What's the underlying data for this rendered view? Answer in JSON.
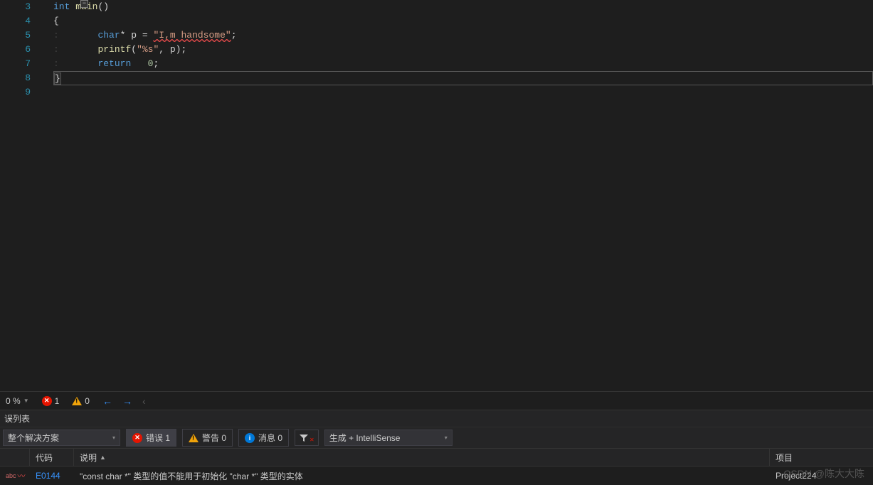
{
  "editor": {
    "lines": [
      "3",
      "4",
      "5",
      "6",
      "7",
      "8",
      "9"
    ],
    "code3_kw1": "int",
    "code3_fn": "main",
    "code3_rest": "()",
    "code4": "{",
    "code5_kw": "char",
    "code5_mid": "* p = ",
    "code5_str": "\"I,m handsome\"",
    "code5_end": ";",
    "code6_fn": "printf",
    "code6_paren": "(",
    "code6_fmt": "\"%s\"",
    "code6_args": ", p)",
    "code6_end": ";",
    "code7_kw": "return",
    "code7_sp": "   ",
    "code7_num": "0",
    "code7_end": ";",
    "code8": "}"
  },
  "statusbar": {
    "zoom": "0 %",
    "errors": "1",
    "warnings": "0"
  },
  "errlist": {
    "title": "误列表",
    "scope": "整个解决方案",
    "errorsBtn": "错误 1",
    "warnBtn": "警告 0",
    "msgBtn": "消息 0",
    "filterCombo": "生成 + IntelliSense"
  },
  "grid": {
    "col_code": "代码",
    "col_desc": "说明",
    "col_proj": "项目",
    "row_code": "E0144",
    "row_desc": "\"const char *\" 类型的值不能用于初始化 \"char *\" 类型的实体",
    "row_proj": "Project224",
    "row_icon_label": "abc"
  },
  "watermark": "CSDN @陈大大陈"
}
